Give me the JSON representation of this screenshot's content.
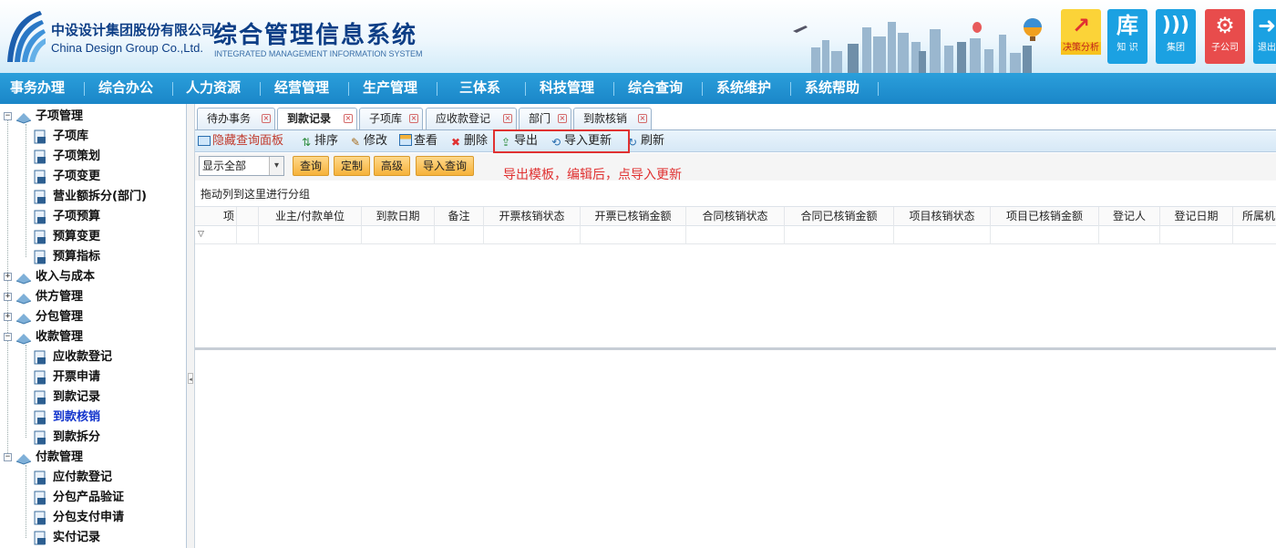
{
  "header": {
    "company_cn": "中设设计集团股份有限公司",
    "company_en": "China Design Group Co.,Ltd.",
    "system_title": "综合管理信息系统",
    "system_subtitle": "INTEGRATED MANAGEMENT INFORMATION SYSTEM",
    "shortcuts": [
      {
        "label": "决策分析",
        "icon": "chart-growth-icon",
        "color": "#f7c21e",
        "glyph": "📈"
      },
      {
        "label": "知  识",
        "icon": "library-icon",
        "color": "#1ba1e2",
        "glyph": "库"
      },
      {
        "label": "集团",
        "icon": "rss-icon",
        "color": "#1ba1e2",
        "glyph": "))"
      },
      {
        "label": "子公司",
        "icon": "gear-icon",
        "color": "#e84c4c",
        "glyph": "⚙"
      },
      {
        "label": "退出",
        "icon": "exit-icon",
        "color": "#1ba1e2",
        "glyph": "➜"
      }
    ]
  },
  "nav": {
    "items": [
      "事务办理",
      "综合办公",
      "人力资源",
      "经营管理",
      "生产管理",
      "三体系",
      "科技管理",
      "综合查询",
      "系统维护",
      "系统帮助"
    ]
  },
  "sidebar": {
    "groups": [
      {
        "label": "子项管理",
        "expanded": true,
        "children": [
          "子项库",
          "子项策划",
          "子项变更",
          "营业额拆分(部门)",
          "子项预算",
          "预算变更",
          "预算指标"
        ]
      },
      {
        "label": "收入与成本",
        "expanded": false,
        "children": []
      },
      {
        "label": "供方管理",
        "expanded": false,
        "children": []
      },
      {
        "label": "分包管理",
        "expanded": false,
        "children": []
      },
      {
        "label": "收款管理",
        "expanded": true,
        "children": [
          "应收款登记",
          "开票申请",
          "到款记录",
          "到款核销",
          "到款拆分"
        ],
        "active_child": "到款核销"
      },
      {
        "label": "付款管理",
        "expanded": true,
        "children": [
          "应付款登记",
          "分包产品验证",
          "分包支付申请",
          "实付记录"
        ]
      }
    ]
  },
  "tabs": [
    {
      "label": "待办事务",
      "active": false
    },
    {
      "label": "到款记录",
      "active": true
    },
    {
      "label": "子项库",
      "active": false
    },
    {
      "label": "应收款登记",
      "active": false
    },
    {
      "label": "部门",
      "active": false
    },
    {
      "label": "到款核销",
      "active": false
    }
  ],
  "toolbar": {
    "hide_panel": "隐藏查询面板",
    "sort": "排序",
    "edit": "修改",
    "view": "查看",
    "delete": "删除",
    "export": "导出",
    "import_update": "导入更新",
    "refresh": "刷新"
  },
  "query": {
    "filter_value": "显示全部",
    "buttons": [
      "查询",
      "定制",
      "高级",
      "导入查询"
    ]
  },
  "annotation": "导出模板，编辑后，点导入更新",
  "grid": {
    "group_hint": "拖动列到这里进行分组",
    "columns": [
      "项",
      "业主/付款单位",
      "到款日期",
      "备注",
      "开票核销状态",
      "开票已核销金额",
      "合同核销状态",
      "合同已核销金额",
      "项目核销状态",
      "项目已核销金额",
      "登记人",
      "登记日期",
      "所属机"
    ]
  },
  "colors": {
    "nav_bg": "#1a86c8",
    "highlight": "#e03131",
    "active_tree": "#1133cc"
  }
}
